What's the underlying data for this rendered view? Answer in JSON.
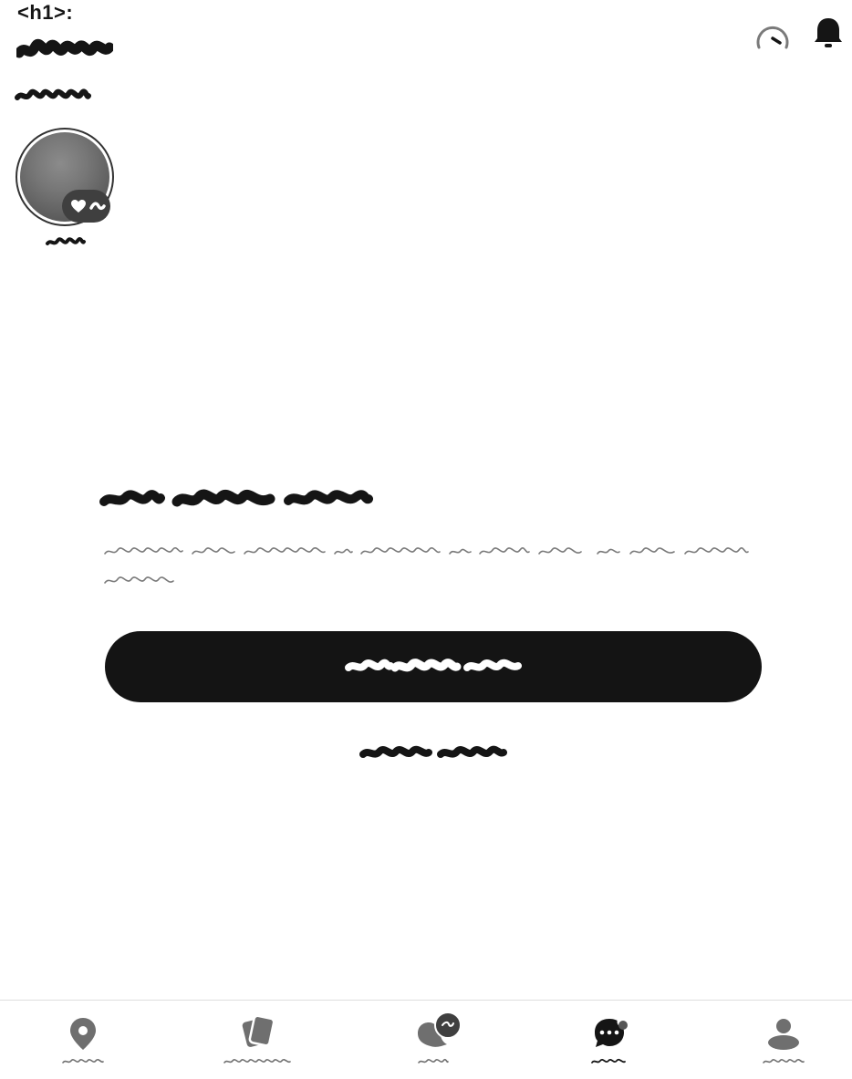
{
  "h1_marker": "<h1>:",
  "header": {
    "title": "",
    "subtitle": ""
  },
  "top_icons": [
    "speedometer-icon",
    "bell-icon"
  ],
  "avatar": {
    "label": "",
    "badge_icons": [
      "heart-icon",
      "wave-icon"
    ]
  },
  "empty_state": {
    "heading": "",
    "description": "",
    "primary_button_label": "",
    "secondary_link_label": ""
  },
  "bottom_nav": {
    "items": [
      {
        "icon": "location-pin-icon",
        "label": "",
        "active": false
      },
      {
        "icon": "cards-icon",
        "label": "",
        "active": false
      },
      {
        "icon": "bubble-badge-icon",
        "label": "",
        "active": false
      },
      {
        "icon": "chat-icon",
        "label": "",
        "active": true,
        "notification_dot": true
      },
      {
        "icon": "person-icon",
        "label": "",
        "active": false
      }
    ]
  },
  "colors": {
    "primary": "#141414",
    "muted": "#7a7a7a",
    "divider": "#dedede",
    "icon": "#6f6f6f"
  }
}
